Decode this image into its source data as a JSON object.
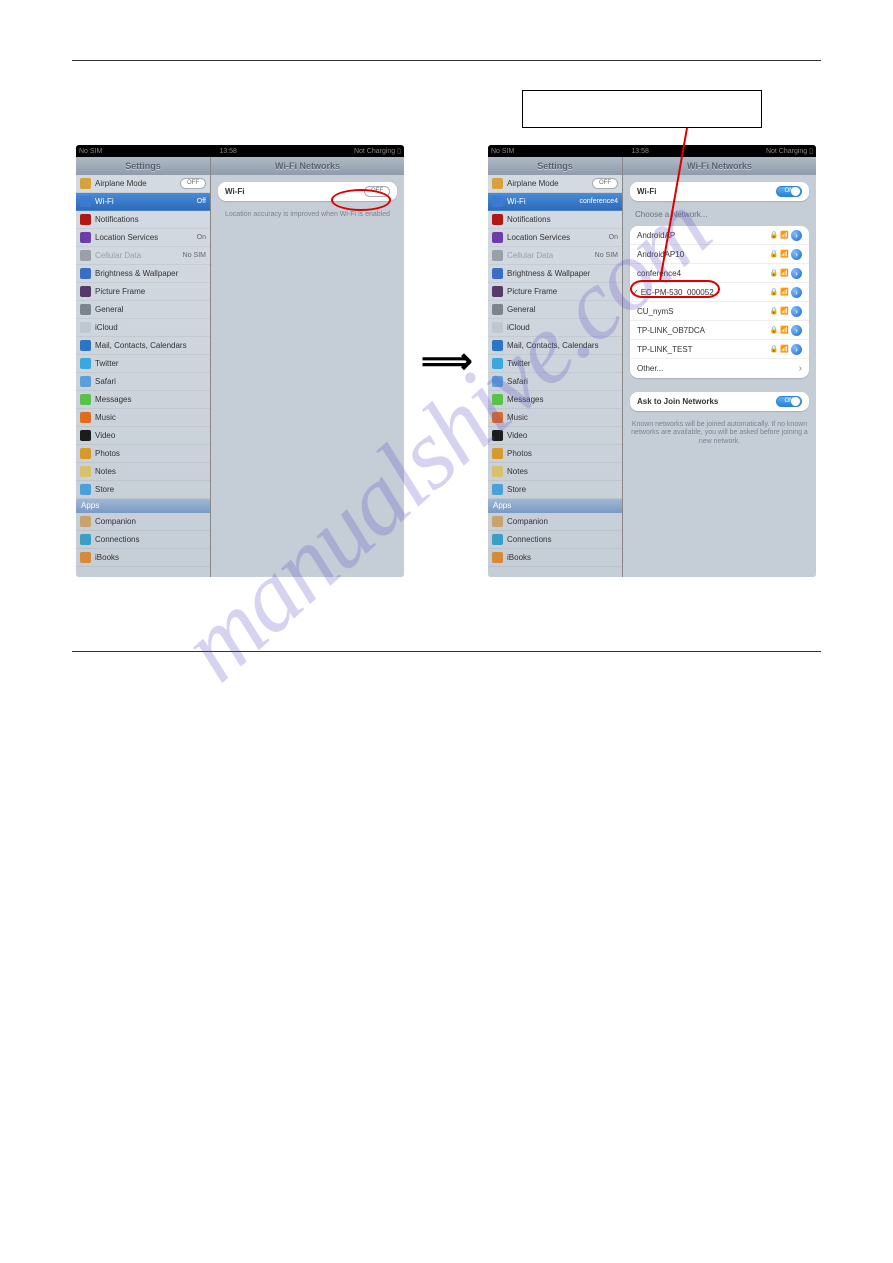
{
  "page": {
    "underline_title": "",
    "watermark": "manualshive.com"
  },
  "callout": {
    "text": ""
  },
  "arrow_glyph": "⟹",
  "screen_left": {
    "status": {
      "left": "No SIM",
      "center": "13:58",
      "right": "Not Charging ▯"
    },
    "sidebar_title": "Settings",
    "main_title": "Wi-Fi Networks",
    "sidebar": [
      {
        "icon": "#d9a13a",
        "label": "Airplane Mode",
        "right_type": "pill_off",
        "right": "OFF"
      },
      {
        "icon": "#3c7bd1",
        "label": "Wi-Fi",
        "right": "Off",
        "active": true
      },
      {
        "icon": "#b01818",
        "label": "Notifications",
        "right": ""
      },
      {
        "icon": "#6d3ea8",
        "label": "Location Services",
        "right": "On"
      },
      {
        "icon": "#9aa0a8",
        "label": "Cellular Data",
        "right": "No SIM",
        "dim": true
      },
      {
        "icon": "#3a6ec4",
        "label": "Brightness & Wallpaper",
        "right": ""
      },
      {
        "icon": "#563a6a",
        "label": "Picture Frame",
        "right": ""
      },
      {
        "icon": "#7c848e",
        "label": "General",
        "right": ""
      },
      {
        "icon": "#bfc8d1",
        "label": "iCloud",
        "right": ""
      },
      {
        "icon": "#2b74c6",
        "label": "Mail, Contacts, Calendars",
        "right": ""
      },
      {
        "icon": "#3aa7e0",
        "label": "Twitter",
        "right": ""
      },
      {
        "icon": "#5aa0d8",
        "label": "Safari",
        "right": ""
      },
      {
        "icon": "#59c24a",
        "label": "Messages",
        "right": ""
      },
      {
        "icon": "#e36b1e",
        "label": "Music",
        "right": ""
      },
      {
        "icon": "#1c1c1c",
        "label": "Video",
        "right": ""
      },
      {
        "icon": "#d79a2a",
        "label": "Photos",
        "right": ""
      },
      {
        "icon": "#d7c16a",
        "label": "Notes",
        "right": ""
      },
      {
        "icon": "#4aa0d8",
        "label": "Store",
        "right": ""
      }
    ],
    "sidebar_apps_header": "Apps",
    "sidebar_apps": [
      {
        "icon": "#c9a36a",
        "label": "Companion"
      },
      {
        "icon": "#3a9fc4",
        "label": "Connections"
      },
      {
        "icon": "#d68a3a",
        "label": "iBooks"
      }
    ],
    "wifi_row": {
      "label": "Wi-Fi",
      "toggle": "OFF"
    },
    "wifi_note": "Location accuracy is improved when\nWi-Fi is enabled"
  },
  "screen_right": {
    "status": {
      "left": "No SIM",
      "center": "13:58",
      "right": "Not Charging ▯"
    },
    "sidebar_title": "Settings",
    "main_title": "Wi-Fi Networks",
    "sidebar": [
      {
        "icon": "#d9a13a",
        "label": "Airplane Mode",
        "right_type": "pill_off",
        "right": "OFF"
      },
      {
        "icon": "#3c7bd1",
        "label": "Wi-Fi",
        "right": "conference4",
        "active": true
      },
      {
        "icon": "#b01818",
        "label": "Notifications",
        "right": ""
      },
      {
        "icon": "#6d3ea8",
        "label": "Location Services",
        "right": "On"
      },
      {
        "icon": "#9aa0a8",
        "label": "Cellular Data",
        "right": "No SIM",
        "dim": true
      },
      {
        "icon": "#3a6ec4",
        "label": "Brightness & Wallpaper",
        "right": ""
      },
      {
        "icon": "#563a6a",
        "label": "Picture Frame",
        "right": ""
      },
      {
        "icon": "#7c848e",
        "label": "General",
        "right": ""
      },
      {
        "icon": "#bfc8d1",
        "label": "iCloud",
        "right": ""
      },
      {
        "icon": "#2b74c6",
        "label": "Mail, Contacts, Calendars",
        "right": ""
      },
      {
        "icon": "#3aa7e0",
        "label": "Twitter",
        "right": ""
      },
      {
        "icon": "#5aa0d8",
        "label": "Safari",
        "right": ""
      },
      {
        "icon": "#59c24a",
        "label": "Messages",
        "right": ""
      },
      {
        "icon": "#e36b1e",
        "label": "Music",
        "right": ""
      },
      {
        "icon": "#1c1c1c",
        "label": "Video",
        "right": ""
      },
      {
        "icon": "#d79a2a",
        "label": "Photos",
        "right": ""
      },
      {
        "icon": "#d7c16a",
        "label": "Notes",
        "right": ""
      },
      {
        "icon": "#4aa0d8",
        "label": "Store",
        "right": ""
      }
    ],
    "sidebar_apps_header": "Apps",
    "sidebar_apps": [
      {
        "icon": "#c9a36a",
        "label": "Companion"
      },
      {
        "icon": "#3a9fc4",
        "label": "Connections"
      },
      {
        "icon": "#d68a3a",
        "label": "iBooks"
      }
    ],
    "wifi_row": {
      "label": "Wi-Fi",
      "toggle": "ON"
    },
    "choose_header": "Choose a Network...",
    "networks": [
      {
        "name": "AndroidAP",
        "lock": true,
        "checked": false
      },
      {
        "name": "AndroidAP10",
        "lock": true,
        "checked": false
      },
      {
        "name": "conference4",
        "lock": true,
        "checked": false
      },
      {
        "name": "EC-PM-530_000052",
        "lock": true,
        "checked": true
      },
      {
        "name": "CU_nymS",
        "lock": true,
        "checked": false
      },
      {
        "name": "TP-LINK_OB7DCA",
        "lock": true,
        "checked": false
      },
      {
        "name": "TP-LINK_TEST",
        "lock": true,
        "checked": false
      },
      {
        "name": "Other...",
        "lock": false,
        "checked": false,
        "noarrow": true
      }
    ],
    "ask_row": {
      "label": "Ask to Join Networks",
      "toggle": "ON"
    },
    "ask_note": "Known networks will be joined automatically. If no known networks are available, you will be asked before joining a new network."
  },
  "glyphs": {
    "lock": "🔒",
    "wifi": "📶",
    "chevron": "›"
  }
}
